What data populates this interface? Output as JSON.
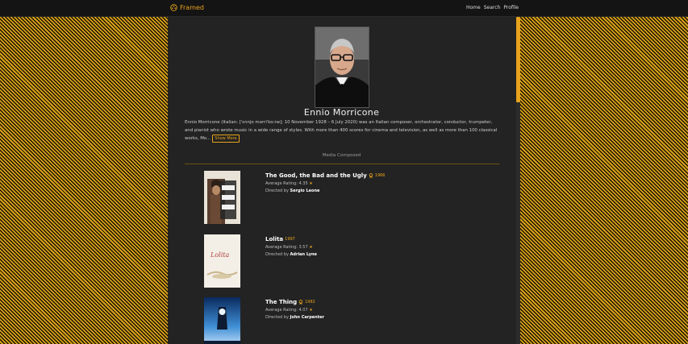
{
  "header": {
    "brand": "Framed",
    "nav": [
      "Home",
      "Search",
      "Profile"
    ]
  },
  "person": {
    "name": "Ennio Morricone",
    "bio": "Ennio Morricone (Italian: [ˈɛnnjo morriˈkoːne]; 10 November 1928 – 6 July 2020) was an Italian composer, orchestrator, conductor, trumpeter, and pianist who wrote music in a wide range of styles. With more than 400 scores for cinema and television, as well as more than 100 classical works, Mo...",
    "show_more": "Show More"
  },
  "section": {
    "label": "Media Composed"
  },
  "films": [
    {
      "title": "The Good, the Bad and the Ugly",
      "year": "1966",
      "rating_label": "Average Rating:",
      "rating": "4.35",
      "directed_label": "Directed by",
      "director": "Sergio Leone",
      "award": true
    },
    {
      "title": "Lolita",
      "year": "1997",
      "rating_label": "Average Rating:",
      "rating": "3.57",
      "directed_label": "Directed by",
      "director": "Adrian Lyne",
      "award": false
    },
    {
      "title": "The Thing",
      "year": "1982",
      "rating_label": "Average Rating:",
      "rating": "4.07",
      "directed_label": "Directed by",
      "director": "John Carpenter",
      "award": true
    }
  ],
  "colors": {
    "accent": "#e8a31b",
    "panel": "#232323",
    "topbar": "#141414"
  },
  "icons": {
    "brand": "film-reel-icon",
    "award": "award-icon",
    "rating": "star-icon"
  }
}
